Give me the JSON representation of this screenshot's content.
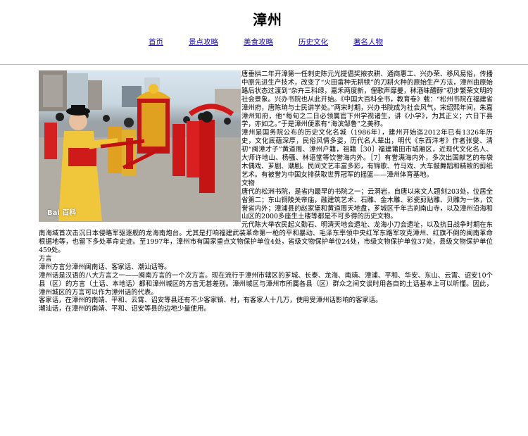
{
  "site": {
    "title": "漳州"
  },
  "nav": {
    "items": [
      {
        "label": "首页"
      },
      {
        "label": "景点攻略"
      },
      {
        "label": "美食攻略"
      },
      {
        "label": "历史文化"
      },
      {
        "label": "著名人物"
      }
    ]
  },
  "photo": {
    "watermark": "Bai 百科"
  },
  "paragraphs": [
    "唐垂拱二年开漳第一任刺史陈元光提倡奖掖农耕、通商惠工、兴办荣、移风易俗，传播中原先进生产技术，改变了“火田畲种无耕犊”的刀耕火种的原始生产方法，漳州由原始路后状态过渡到“杂卉三科绿，嘉禾两度新，俚歌声靡曼，秫酒味醴醇”初步繁荣文明的社会景象。兴办书院也从此开始。《中国大百科全书，教育卷》载：“松州书院在福建省漳州府，唐陈珦与士民讲学处。”两宋时期，兴办书院成为社会风气，宋绍熙年间，朱嘉漳州知府，他“每旬之二日必领属官下州学视诸生，讲《小学》，为其正义；六日下县学，亦如之。”于是漳州便素有“海滨邹鲁”之美称。",
    "漳州是国务院公布的历史文化名城（1986年），建州开始迄2012年已有1326年历史，文化底蕴深厚，民俗风情多姿，历代名人辈出，明代《东西洋考》作者张燮、清初“闽漳才子”黄道周、漳州户籍，祖籍［30］福建莆田市城厢区，近现代文化名人、大师许地山、杨骚、林语堂等饮誉海内外。［7］有誉满海内外，多次出国献艺的布袋木偶戏、芗剧、潮剧。民间文艺丰富多彩，有锦歌、竹马戏、大车鼓舞蹈和精致的剪纸艺术。有被誉为中国女排获取世界冠军的摇篮——漳州体育基地。",
    "文物",
    "唐代的松洲书院，是省内最早的书院之一；云洞岩，自唐以来文人题刻203处，位居全省第二；东山铜陵关帝庙，融建筑艺术、石雕、金木雕、彩瓷剪贴雕、贝雕为一体，饮誉省内外；漳浦县的赵家堡和黄道周天地盘，芗城区千年古刹南山寺，以及漳州沿海和山区的2000多座生土楼等都是不可多得的历史文物。",
    "元代陈大举农民起义勤石、明清天地会遗址、龙海小刀会遗址，以及抗日战争时期在东南海域首次击沉日本侵略军驱逐舰的龙海南炮台。尤其是打响福建武装革命第一枪的平和暴动、毛泽东率领中央红军东路军攻克漳州、红旗不倒的闽南革命根据地等，也留下多处革命史迹。至1997年，漳州市有国家重点文物保护单位4处，省级文物保护单位24处，市级文物保护单位37处，县级文物保护单位459处。",
    "方言",
    "漳州方言分漳州闽南话、客家话、潮汕话等。",
    "漳州话是汉语的八大方言之一——闽南方言的一个次方言。现在流行于漳州市辖区的芗城、长泰、龙海、南靖、漳浦、平和、华安、东山、云霄、诏安10个县（区）的方言（土话、本地话）都和漳州城区的方言无甚差别。漳州城区与漳州市所属各县（区）群众之间交谈时用各自的土话基本上可以听懂。因此，漳州城区的方言可以作为漳州话的代表。",
    "客家话，在漳州的南靖、平和、云霄、诏安等县还有不少客家镇、村，有客家人十几万，使用受漳州话影响的客家话。",
    "潮汕话，在漳州的南靖、平和、诏安等县的边地少量使用。"
  ]
}
